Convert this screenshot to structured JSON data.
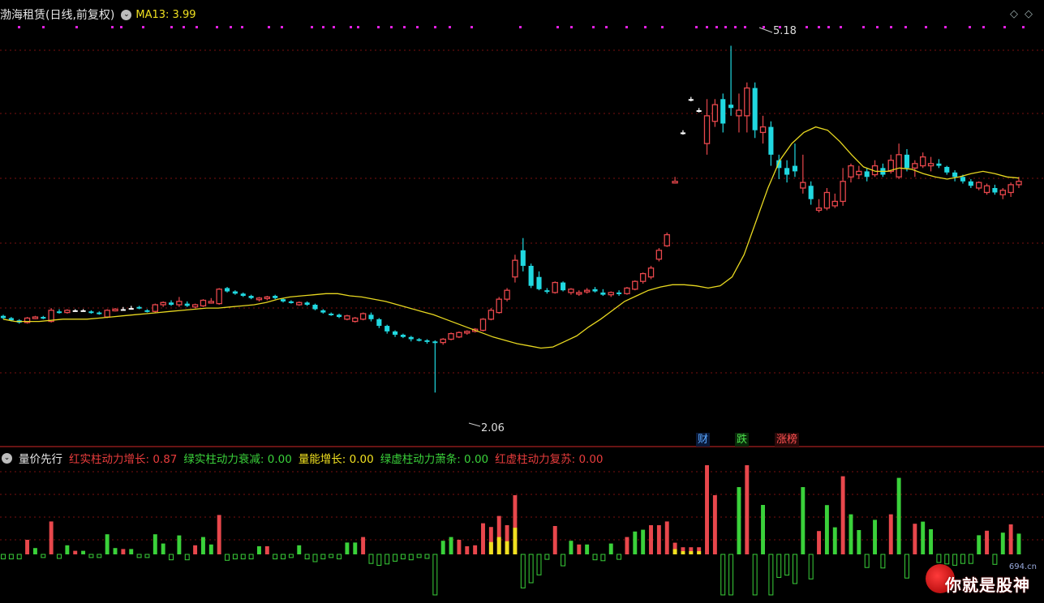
{
  "main": {
    "title": "渤海租赁(日线,前复权)",
    "ma_label": "MA13: 3.99",
    "diamonds": "◇◇",
    "high_label": "5.18",
    "low_label": "2.06",
    "tags": {
      "cai": "财",
      "die": "跌",
      "zhang": "涨榜"
    }
  },
  "indicator": {
    "name": "量价先行",
    "items": [
      {
        "label": "红实柱动力增长: 0.87",
        "color": "red"
      },
      {
        "label": "绿实柱动力衰减: 0.00",
        "color": "green"
      },
      {
        "label": "量能增长: 0.00",
        "color": "yellow"
      },
      {
        "label": "绿虚柱动力萧条: 0.00",
        "color": "green"
      },
      {
        "label": "红虚柱动力复苏: 0.00",
        "color": "red"
      }
    ]
  },
  "watermark": {
    "text": "你就是股神",
    "site": "694.cn"
  },
  "colors": {
    "up": "#e8474c",
    "down": "#20d8e0",
    "flat": "#ffffff",
    "ma": "#e8d820",
    "grid": "#7a1010",
    "magenta": "#e020e0"
  },
  "chart_data": [
    {
      "type": "candlestick",
      "title": "渤海租赁(日线,前复权)",
      "ylim": [
        1.8,
        5.3
      ],
      "series": [
        {
          "name": "MA13",
          "values": [
            2.72,
            2.7,
            2.7,
            2.7,
            2.71,
            2.72,
            2.72,
            2.72,
            2.73,
            2.74,
            2.75,
            2.76,
            2.77,
            2.78,
            2.79,
            2.8,
            2.81,
            2.82,
            2.82,
            2.83,
            2.84,
            2.85,
            2.87,
            2.9,
            2.92,
            2.93,
            2.94,
            2.95,
            2.95,
            2.93,
            2.92,
            2.9,
            2.88,
            2.85,
            2.82,
            2.79,
            2.76,
            2.72,
            2.68,
            2.64,
            2.6,
            2.56,
            2.53,
            2.5,
            2.48,
            2.46,
            2.47,
            2.52,
            2.57,
            2.65,
            2.72,
            2.8,
            2.88,
            2.93,
            2.98,
            3.01,
            3.03,
            3.03,
            3.02,
            3.0,
            3.02,
            3.1,
            3.3,
            3.6,
            3.9,
            4.15,
            4.3,
            4.4,
            4.45,
            4.42,
            4.32,
            4.2,
            4.09,
            4.05,
            4.05,
            4.08,
            4.07,
            4.03,
            4.0,
            3.98,
            4.0,
            4.03,
            4.05,
            4.03,
            4.0,
            3.99
          ]
        }
      ],
      "candles_ohlc": [
        [
          2.75,
          2.76,
          2.72,
          2.73
        ],
        [
          2.73,
          2.74,
          2.7,
          2.71
        ],
        [
          2.71,
          2.72,
          2.68,
          2.69
        ],
        [
          2.69,
          2.74,
          2.68,
          2.73
        ],
        [
          2.73,
          2.75,
          2.72,
          2.74
        ],
        [
          2.74,
          2.75,
          2.72,
          2.73
        ],
        [
          2.7,
          2.82,
          2.69,
          2.8
        ],
        [
          2.79,
          2.81,
          2.77,
          2.78
        ],
        [
          2.78,
          2.81,
          2.77,
          2.8
        ],
        [
          2.8,
          2.81,
          2.79,
          2.8
        ],
        [
          2.8,
          2.81,
          2.79,
          2.8
        ],
        [
          2.79,
          2.8,
          2.77,
          2.78
        ],
        [
          2.78,
          2.79,
          2.76,
          2.77
        ],
        [
          2.74,
          2.81,
          2.73,
          2.8
        ],
        [
          2.8,
          2.82,
          2.79,
          2.81
        ],
        [
          2.81,
          2.83,
          2.8,
          2.81
        ],
        [
          2.82,
          2.84,
          2.81,
          2.82
        ],
        [
          2.83,
          2.84,
          2.81,
          2.82
        ],
        [
          2.8,
          2.81,
          2.78,
          2.79
        ],
        [
          2.79,
          2.86,
          2.78,
          2.85
        ],
        [
          2.85,
          2.88,
          2.83,
          2.87
        ],
        [
          2.87,
          2.89,
          2.84,
          2.85
        ],
        [
          2.85,
          2.92,
          2.83,
          2.88
        ],
        [
          2.86,
          2.88,
          2.83,
          2.84
        ],
        [
          2.83,
          2.86,
          2.82,
          2.85
        ],
        [
          2.84,
          2.9,
          2.83,
          2.89
        ],
        [
          2.87,
          2.91,
          2.86,
          2.88
        ],
        [
          2.86,
          3.0,
          2.85,
          2.99
        ],
        [
          3.0,
          3.01,
          2.96,
          2.97
        ],
        [
          2.97,
          2.98,
          2.94,
          2.95
        ],
        [
          2.95,
          2.96,
          2.92,
          2.93
        ],
        [
          2.93,
          2.94,
          2.9,
          2.91
        ],
        [
          2.9,
          2.92,
          2.88,
          2.91
        ],
        [
          2.91,
          2.93,
          2.89,
          2.92
        ],
        [
          2.93,
          2.94,
          2.9,
          2.91
        ],
        [
          2.9,
          2.91,
          2.87,
          2.88
        ],
        [
          2.88,
          2.89,
          2.86,
          2.87
        ],
        [
          2.85,
          2.88,
          2.84,
          2.87
        ],
        [
          2.87,
          2.88,
          2.84,
          2.85
        ],
        [
          2.85,
          2.86,
          2.8,
          2.81
        ],
        [
          2.8,
          2.81,
          2.77,
          2.78
        ],
        [
          2.77,
          2.78,
          2.75,
          2.76
        ],
        [
          2.76,
          2.77,
          2.73,
          2.74
        ],
        [
          2.72,
          2.76,
          2.71,
          2.75
        ],
        [
          2.7,
          2.74,
          2.69,
          2.73
        ],
        [
          2.72,
          2.78,
          2.71,
          2.77
        ],
        [
          2.76,
          2.78,
          2.7,
          2.72
        ],
        [
          2.72,
          2.73,
          2.64,
          2.66
        ],
        [
          2.66,
          2.67,
          2.59,
          2.61
        ],
        [
          2.61,
          2.62,
          2.56,
          2.58
        ],
        [
          2.58,
          2.59,
          2.55,
          2.56
        ],
        [
          2.56,
          2.57,
          2.52,
          2.54
        ],
        [
          2.54,
          2.55,
          2.52,
          2.53
        ],
        [
          2.53,
          2.54,
          2.5,
          2.52
        ],
        [
          2.52,
          2.53,
          2.06,
          2.51
        ],
        [
          2.51,
          2.55,
          2.49,
          2.54
        ],
        [
          2.54,
          2.6,
          2.53,
          2.59
        ],
        [
          2.56,
          2.61,
          2.55,
          2.6
        ],
        [
          2.6,
          2.62,
          2.58,
          2.61
        ],
        [
          2.61,
          2.64,
          2.6,
          2.63
        ],
        [
          2.62,
          2.73,
          2.61,
          2.72
        ],
        [
          2.72,
          2.82,
          2.71,
          2.8
        ],
        [
          2.78,
          2.92,
          2.77,
          2.9
        ],
        [
          2.9,
          3.0,
          2.88,
          2.98
        ],
        [
          3.1,
          3.3,
          3.05,
          3.25
        ],
        [
          3.34,
          3.45,
          3.15,
          3.2
        ],
        [
          3.2,
          3.22,
          3.0,
          3.02
        ],
        [
          3.1,
          3.15,
          2.98,
          2.99
        ],
        [
          2.98,
          3.0,
          2.95,
          2.97
        ],
        [
          2.96,
          3.06,
          2.95,
          3.05
        ],
        [
          3.05,
          3.06,
          2.97,
          2.98
        ],
        [
          2.96,
          3.0,
          2.94,
          2.99
        ],
        [
          2.95,
          2.98,
          2.93,
          2.96
        ],
        [
          2.97,
          3.0,
          2.95,
          2.98
        ],
        [
          2.99,
          3.01,
          2.96,
          2.97
        ],
        [
          2.96,
          2.99,
          2.93,
          2.94
        ],
        [
          2.94,
          2.97,
          2.92,
          2.96
        ],
        [
          2.96,
          2.98,
          2.93,
          2.95
        ],
        [
          2.95,
          3.01,
          2.94,
          3.0
        ],
        [
          2.99,
          3.07,
          2.98,
          3.06
        ],
        [
          3.06,
          3.14,
          3.04,
          3.13
        ],
        [
          3.1,
          3.2,
          3.08,
          3.18
        ],
        [
          3.26,
          3.36,
          3.24,
          3.34
        ],
        [
          3.38,
          3.5,
          3.37,
          3.48
        ],
        [
          3.95,
          4.0,
          3.94,
          3.96
        ],
        [
          4.4,
          4.42,
          4.38,
          4.4
        ],
        [
          4.7,
          4.72,
          4.68,
          4.7
        ],
        [
          4.6,
          4.62,
          4.58,
          4.6
        ],
        [
          4.3,
          4.7,
          4.2,
          4.55
        ],
        [
          4.5,
          4.7,
          4.45,
          4.65
        ],
        [
          4.7,
          4.75,
          4.4,
          4.48
        ],
        [
          4.65,
          5.18,
          4.55,
          4.62
        ],
        [
          4.55,
          4.75,
          4.4,
          4.6
        ],
        [
          4.55,
          4.85,
          4.4,
          4.8
        ],
        [
          4.8,
          4.85,
          4.35,
          4.42
        ],
        [
          4.4,
          4.55,
          4.3,
          4.45
        ],
        [
          4.45,
          4.5,
          4.1,
          4.2
        ],
        [
          4.15,
          4.2,
          3.98,
          4.08
        ],
        [
          4.08,
          4.15,
          3.95,
          4.02
        ],
        [
          4.1,
          4.3,
          4.0,
          4.05
        ],
        [
          3.9,
          4.2,
          3.85,
          3.95
        ],
        [
          3.92,
          3.96,
          3.75,
          3.8
        ],
        [
          3.7,
          3.8,
          3.68,
          3.72
        ],
        [
          3.72,
          3.9,
          3.7,
          3.86
        ],
        [
          3.74,
          3.85,
          3.72,
          3.78
        ],
        [
          3.78,
          4.08,
          3.74,
          3.96
        ],
        [
          4.0,
          4.12,
          3.95,
          4.1
        ],
        [
          4.02,
          4.1,
          3.98,
          4.05
        ],
        [
          4.05,
          4.08,
          3.96,
          4.0
        ],
        [
          4.02,
          4.15,
          4.0,
          4.1
        ],
        [
          4.08,
          4.12,
          4.0,
          4.02
        ],
        [
          4.05,
          4.2,
          4.03,
          4.15
        ],
        [
          4.0,
          4.3,
          3.98,
          4.2
        ],
        [
          4.2,
          4.25,
          4.05,
          4.08
        ],
        [
          4.08,
          4.15,
          4.0,
          4.12
        ],
        [
          4.1,
          4.22,
          4.08,
          4.18
        ],
        [
          4.1,
          4.18,
          4.05,
          4.12
        ],
        [
          4.12,
          4.16,
          4.08,
          4.1
        ],
        [
          4.09,
          4.1,
          4.02,
          4.04
        ],
        [
          4.04,
          4.06,
          3.96,
          4.0
        ],
        [
          4.0,
          4.02,
          3.94,
          3.96
        ],
        [
          3.96,
          3.98,
          3.9,
          3.92
        ],
        [
          3.9,
          3.96,
          3.88,
          3.95
        ],
        [
          3.86,
          3.94,
          3.84,
          3.92
        ],
        [
          3.9,
          3.93,
          3.84,
          3.86
        ],
        [
          3.84,
          3.9,
          3.8,
          3.88
        ],
        [
          3.86,
          3.95,
          3.82,
          3.93
        ],
        [
          3.93,
          4.0,
          3.9,
          3.96
        ]
      ]
    },
    {
      "type": "bar",
      "title": "量价先行",
      "series": [
        {
          "name": "红实柱动力增长",
          "color": "red"
        },
        {
          "name": "绿实柱动力衰减",
          "color": "green"
        },
        {
          "name": "量能增长",
          "color": "yellow"
        },
        {
          "name": "绿虚柱动力萧条",
          "color": "green"
        },
        {
          "name": "红虚柱动力复苏",
          "color": "red"
        }
      ],
      "ylim": [
        -1.0,
        1.9
      ]
    }
  ]
}
